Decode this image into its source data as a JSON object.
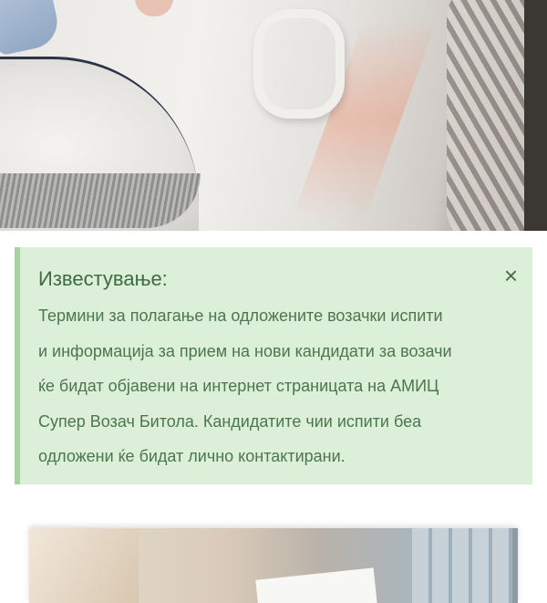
{
  "notice": {
    "title": "Известување:",
    "close_symbol": "×",
    "lines": [
      "Термини за полагање на одложените возачки испити",
      "и информација за прием на нови кандидати за возачи",
      "ќе бидат објавени на интернет страницата на АМИЦ",
      "Супер Возач Битола. Кандидатите чии испити беа",
      "одложени ќе бидат лично контактирани."
    ]
  },
  "colors": {
    "notice_bg": "#dcefd8",
    "notice_border": "#a7d3a0",
    "notice_text": "#4d7550"
  }
}
